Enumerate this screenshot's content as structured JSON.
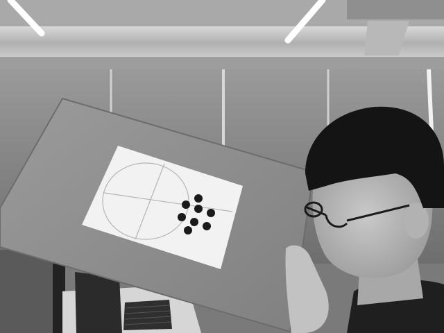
{
  "scene": {
    "kind": "grayscale-photo",
    "subjects": [
      "person",
      "cardboard-board",
      "calibration-target",
      "ceiling-lights",
      "monitor",
      "keyboard"
    ]
  },
  "target": {
    "dot_count": 8
  },
  "colors": {
    "background": "#7a7a7a",
    "ceiling": "#a9a9a9",
    "duct": "#c4c4c4",
    "light": "#ffffff",
    "wall": "#8d8d8d",
    "cardboard": "#8f8f8f",
    "paper": "#f2f2f2",
    "dot": "#1a1a1a",
    "hair": "#141414",
    "skin": "#bdbdbd",
    "shirt": "#1f1f1f"
  }
}
